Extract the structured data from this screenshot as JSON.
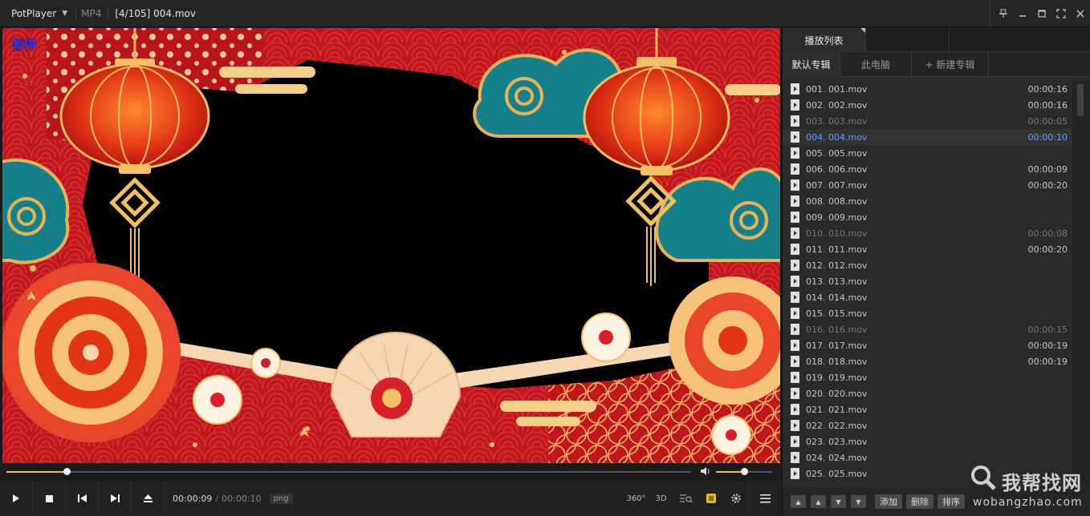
{
  "titlebar": {
    "app_name": "PotPlayer",
    "format": "MP4",
    "file_title": "[4/105] 004.mov",
    "controls": [
      "pin-icon",
      "minimize-icon",
      "maximize-icon",
      "fullscreen-icon",
      "close-icon"
    ]
  },
  "video": {
    "status_text": "暂停"
  },
  "seek": {
    "progress": 0.088,
    "volume": 0.5
  },
  "controls": {
    "current_time": "00:00:09",
    "separator": "/",
    "total_time": "00:00:10",
    "codec": "png",
    "vr_label": "360°",
    "3d_label": "3D"
  },
  "playlist": {
    "panel_tab": "播放列表",
    "album_tabs": [
      "默认专辑",
      "此电脑",
      "+ 新建专辑"
    ],
    "items": [
      {
        "name": "001. 001.mov",
        "duration": "00:00:16",
        "state": "normal"
      },
      {
        "name": "002. 002.mov",
        "duration": "00:00:16",
        "state": "normal"
      },
      {
        "name": "003. 003.mov",
        "duration": "00:00:05",
        "state": "dim"
      },
      {
        "name": "004. 004.mov",
        "duration": "00:00:10",
        "state": "current"
      },
      {
        "name": "005. 005.mov",
        "duration": "",
        "state": "normal"
      },
      {
        "name": "006. 006.mov",
        "duration": "00:00:09",
        "state": "normal"
      },
      {
        "name": "007. 007.mov",
        "duration": "00:00:20",
        "state": "normal"
      },
      {
        "name": "008. 008.mov",
        "duration": "",
        "state": "normal"
      },
      {
        "name": "009. 009.mov",
        "duration": "",
        "state": "normal"
      },
      {
        "name": "010. 010.mov",
        "duration": "00:00:08",
        "state": "dim"
      },
      {
        "name": "011. 011.mov",
        "duration": "00:00:20",
        "state": "normal"
      },
      {
        "name": "012. 012.mov",
        "duration": "",
        "state": "normal"
      },
      {
        "name": "013. 013.mov",
        "duration": "",
        "state": "normal"
      },
      {
        "name": "014. 014.mov",
        "duration": "",
        "state": "normal"
      },
      {
        "name": "015. 015.mov",
        "duration": "",
        "state": "normal"
      },
      {
        "name": "016. 016.mov",
        "duration": "00:00:15",
        "state": "dim"
      },
      {
        "name": "017. 017.mov",
        "duration": "00:00:19",
        "state": "normal"
      },
      {
        "name": "018. 018.mov",
        "duration": "00:00:19",
        "state": "normal"
      },
      {
        "name": "019. 019.mov",
        "duration": "",
        "state": "normal"
      },
      {
        "name": "020. 020.mov",
        "duration": "",
        "state": "normal"
      },
      {
        "name": "021. 021.mov",
        "duration": "",
        "state": "normal"
      },
      {
        "name": "022. 022.mov",
        "duration": "",
        "state": "normal"
      },
      {
        "name": "023. 023.mov",
        "duration": "",
        "state": "normal"
      },
      {
        "name": "024. 024.mov",
        "duration": "",
        "state": "normal"
      },
      {
        "name": "025. 025.mov",
        "duration": "",
        "state": "normal"
      }
    ],
    "bottom_buttons": [
      "添加",
      "删除",
      "排序"
    ]
  },
  "watermark": {
    "title": "我帮找网",
    "url": "wobangzhao.com"
  },
  "colors": {
    "accent": "#e8c14a",
    "current_item": "#5aa0ff",
    "video_bg": "#b8141a"
  }
}
